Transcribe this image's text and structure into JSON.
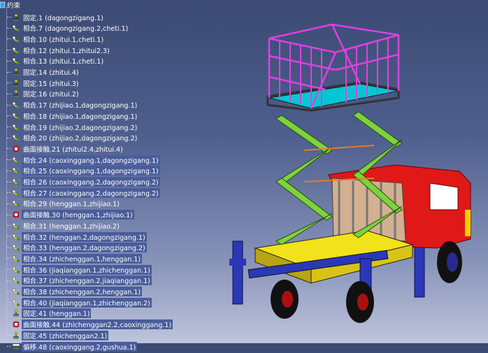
{
  "tree": {
    "root_label": "约束",
    "constraints": [
      {
        "label": "固定.1 (dagongzigang.1)",
        "icon": "fix-anchor-icon",
        "hl": false
      },
      {
        "label": "相合.7 (dagongzigang.2,cheti.1)",
        "icon": "coincidence-icon",
        "hl": false
      },
      {
        "label": "相合.10 (zhitui.1,cheti.1)",
        "icon": "coincidence-icon",
        "hl": false
      },
      {
        "label": "相合.12 (zhitui.1,zhitui2.3)",
        "icon": "coincidence-icon",
        "hl": false
      },
      {
        "label": "相合.13 (zhitui.1,cheti.1)",
        "icon": "coincidence-icon",
        "hl": false
      },
      {
        "label": "固定.14 (zhitui.4)",
        "icon": "fix-anchor-icon",
        "hl": false
      },
      {
        "label": "固定.15 (zhitui.3)",
        "icon": "fix-anchor-icon",
        "hl": false
      },
      {
        "label": "固定.16 (zhitui.2)",
        "icon": "fix-anchor-icon",
        "hl": false
      },
      {
        "label": "相合.17 (zhijiao.1,dagongzigang.1)",
        "icon": "coincidence-icon",
        "hl": false
      },
      {
        "label": "相合.18 (zhijiao.1,dagongzigang.1)",
        "icon": "coincidence-icon",
        "hl": false
      },
      {
        "label": "相合.19 (zhijiao.2,dagongzigang.2)",
        "icon": "coincidence-icon",
        "hl": false
      },
      {
        "label": "相合.20 (zhijiao.2,dagongzigang.2)",
        "icon": "coincidence-icon",
        "hl": false
      },
      {
        "label": "曲面接触.21 (zhitui2.4,zhitui.4)",
        "icon": "surface-contact-icon",
        "hl": false
      },
      {
        "label": "相合.24 (caoxinggang.1,dagongzigang.1)",
        "icon": "coincidence-icon",
        "hl": true
      },
      {
        "label": "相合.25 (caoxinggang.1,dagongzigang.1)",
        "icon": "coincidence-icon",
        "hl": true
      },
      {
        "label": "相合.26 (caoxinggang.2,dagongzigang.2)",
        "icon": "coincidence-icon",
        "hl": true
      },
      {
        "label": "相合.27 (caoxinggang.2,dagongzigang.2)",
        "icon": "coincidence-icon",
        "hl": true
      },
      {
        "label": "相合.29 (henggan.1,zhijiao.1)",
        "icon": "coincidence-icon",
        "hl": false
      },
      {
        "label": "曲面接触.30 (henggan.1,zhijiao.1)",
        "icon": "surface-contact-icon",
        "hl": true
      },
      {
        "label": "相合.31 (henggan.1,zhijiao.2)",
        "icon": "coincidence-icon",
        "hl": false
      },
      {
        "label": "相合.32 (henggan.2,dagongzigang.1)",
        "icon": "coincidence-icon",
        "hl": true
      },
      {
        "label": "相合.33 (henggan.2,dagongzigang.2)",
        "icon": "coincidence-icon",
        "hl": true
      },
      {
        "label": "相合.34 (zhichenggan.1,henggan.1)",
        "icon": "coincidence-icon",
        "hl": true
      },
      {
        "label": "相合.36 (jiaqianggan.1,zhichenggan.1)",
        "icon": "coincidence-icon",
        "hl": true
      },
      {
        "label": "相合.37 (zhichenggan.2,jiaqianggan.1)",
        "icon": "coincidence-icon",
        "hl": true
      },
      {
        "label": "相合.38 (zhichenggan.2,henggan.1)",
        "icon": "coincidence-icon",
        "hl": true
      },
      {
        "label": "相合.40 (jiaqianggan.1,zhichenggan.2)",
        "icon": "coincidence-icon",
        "hl": true
      },
      {
        "label": "固定.41 (henggan.1)",
        "icon": "fix-anchor-icon",
        "hl": true
      },
      {
        "label": "曲面接触.44 (zhichenggan2.2,caoxinggang.1)",
        "icon": "surface-contact-icon",
        "hl": true
      },
      {
        "label": "固定.45 (zhichenggan2.1)",
        "icon": "fix-anchor-icon",
        "hl": true
      },
      {
        "label": "偏移.48 (caoxinggang.2,gushua.1)",
        "icon": "offset-icon",
        "hl": true
      }
    ]
  },
  "colors": {
    "cage": "#e040e0",
    "floor": "#00c8d2",
    "scissor": "#7dd33b",
    "chassis": "#f2e21b",
    "body": "#e01818",
    "outrigger": "#2a38b8",
    "wheel": "#111111"
  }
}
